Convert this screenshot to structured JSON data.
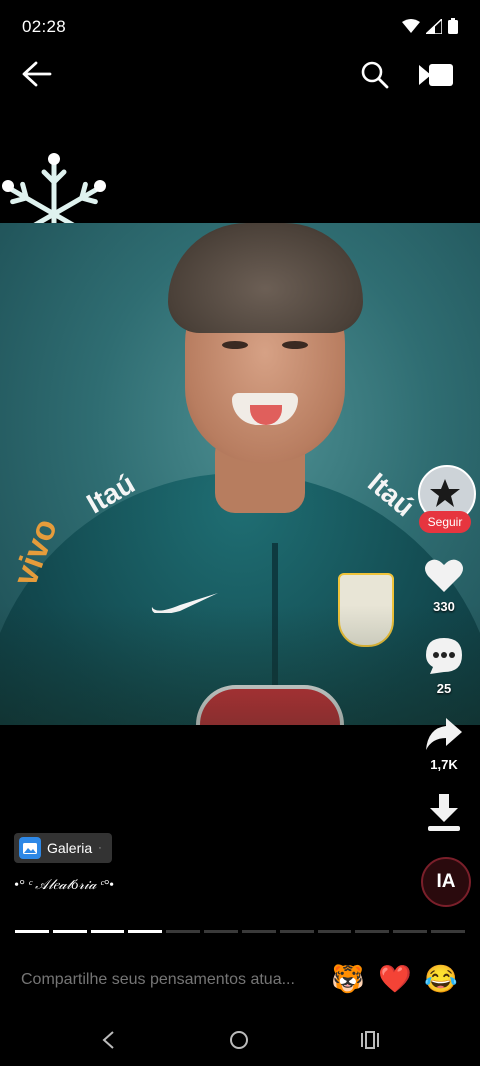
{
  "status_bar": {
    "time": "02:28"
  },
  "topbar": {
    "back": "back",
    "search": "search",
    "live": "live"
  },
  "video": {
    "jersey_sponsor_left": "vivo",
    "jersey_text_left": "Itaú",
    "jersey_text_right": "Itaú"
  },
  "actions": {
    "follow_label": "Seguir",
    "likes": "330",
    "comments": "25",
    "shares": "1,7K",
    "ia_label": "IA"
  },
  "info": {
    "gallery_label": "Galeria",
    "gallery_dot": "·",
    "caption": "•° ᶜ 𝒜𝓁𝑒𝒶𝓉ó𝓇𝒾𝒶 ᶜ°•"
  },
  "progress": {
    "segments_total": 12,
    "segments_done": 4
  },
  "comment_bar": {
    "placeholder": "Compartilhe seus pensamentos atua...",
    "emojis": [
      "🐯",
      "❤️",
      "😂"
    ]
  },
  "colors": {
    "follow": "#e6353f",
    "accent_red": "#e6353f"
  }
}
